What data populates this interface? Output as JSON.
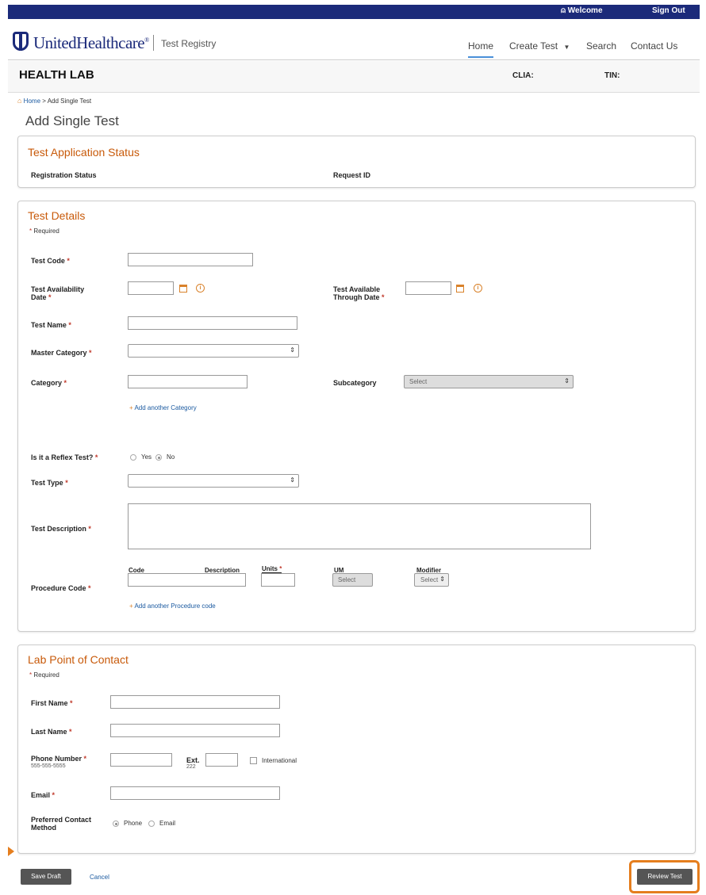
{
  "topbar": {
    "welcome": "Welcome",
    "sign_out": "Sign Out",
    "person_icon": "person-icon"
  },
  "header": {
    "brand": "UnitedHealthcare",
    "brand_mark": "®",
    "app": "Test Registry",
    "nav": {
      "home": "Home",
      "create_test": "Create Test",
      "create_caret": "▼",
      "search": "Search",
      "contact": "Contact Us"
    }
  },
  "labbar": {
    "lab_name": "HEALTH LAB",
    "clia": "CLIA:",
    "tin": "TIN:"
  },
  "breadcrumb": {
    "home": "Home",
    "sep": ">",
    "current": "Add Single Test"
  },
  "page_title": "Add Single Test",
  "status_panel": {
    "title": "Test Application Status",
    "registration_status": "Registration Status",
    "request_id": "Request ID"
  },
  "test_details": {
    "title": "Test Details",
    "required": "Required",
    "star": "*",
    "test_code": "Test Code",
    "availability_date_1": "Test Availability",
    "availability_date_2": "Date",
    "available_through_1": "Test Available",
    "available_through_2": "Through Date",
    "test_name": "Test Name",
    "master_category": "Master Category",
    "category": "Category",
    "subcategory": "Subcategory",
    "subcategory_placeholder": "Select",
    "add_category": "Add another Category",
    "plus": "+",
    "reflex": "Is it a Reflex Test?",
    "reflex_yes": "Yes",
    "reflex_no": "No",
    "reflex_selected": "No",
    "test_type": "Test Type",
    "description": "Test Description",
    "procedure_code": "Procedure Code",
    "proc_cols": {
      "code": "Code",
      "description": "Description",
      "units": "Units",
      "um": "UM",
      "modifier": "Modifier"
    },
    "um_placeholder": "Select",
    "modifier_placeholder": "Select",
    "select_arrow": "⇕",
    "add_procedure": "Add another Procedure code",
    "info_glyph": "i"
  },
  "contact_panel": {
    "title": "Lab Point of Contact",
    "required": "Required",
    "first_name": "First Name",
    "last_name": "Last Name",
    "phone": "Phone Number",
    "phone_hint": "555-555-5555",
    "ext": "Ext.",
    "ext_hint": "222",
    "international": "International",
    "email": "Email",
    "preferred_1": "Preferred Contact",
    "preferred_2": "Method",
    "pref_phone": "Phone",
    "pref_email": "Email",
    "pref_selected": "Phone"
  },
  "footer": {
    "save_draft": "Save Draft",
    "cancel": "Cancel",
    "review_test": "Review Test"
  },
  "colors": {
    "navy": "#1b2a7a",
    "orange": "#c85a0a",
    "highlight": "#e57e1e",
    "link": "#1b5aa0"
  }
}
